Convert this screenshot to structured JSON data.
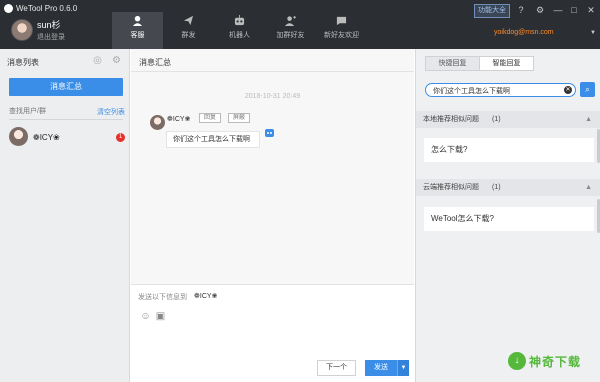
{
  "app": {
    "title": "WeTool Pro 0.6.0"
  },
  "user": {
    "name": "sun杉",
    "logout": "退出登录",
    "email": "yoikdog@msn.com"
  },
  "nav": [
    {
      "label": "客服",
      "icon": "customer-service-icon"
    },
    {
      "label": "群发",
      "icon": "send-icon"
    },
    {
      "label": "机器人",
      "icon": "robot-icon"
    },
    {
      "label": "加群好友",
      "icon": "add-friend-icon"
    },
    {
      "label": "新好友欢迎",
      "icon": "welcome-icon"
    }
  ],
  "top": {
    "feature_btn": "功能大全"
  },
  "left": {
    "title": "消息列表",
    "summary_btn": "消息汇总",
    "search_placeholder": "查找用户/群",
    "clear_list": "清空列表",
    "contacts": [
      {
        "name": "ICY",
        "unread": "1"
      }
    ]
  },
  "middle": {
    "title": "消息汇总",
    "timestamp": "2018-10-31 20:49",
    "message": {
      "sender": "ICY",
      "tag_reply": "回复",
      "tag_filter": "屏蔽",
      "text": "你们这个工具怎么下载啊"
    },
    "compose": {
      "send_to_label": "发送以下信息到",
      "send_to_name": "ICY",
      "next_btn": "下一个",
      "send_btn": "发送"
    }
  },
  "right": {
    "tabs": [
      "快捷回复",
      "智能回复"
    ],
    "search_value": "你们这个工具怎么下载啊",
    "sections": [
      {
        "title": "本地推荐相似问题",
        "count": "(1)",
        "items": [
          "怎么下载?"
        ]
      },
      {
        "title": "云端推荐相似问题",
        "count": "(1)",
        "items": [
          "WeTool怎么下载?"
        ]
      }
    ]
  },
  "watermark": "神奇下载",
  "colors": {
    "accent": "#3b8ee8",
    "topbar": "#2b2e33",
    "email": "#ff8a2a",
    "badge": "#e7302a"
  }
}
